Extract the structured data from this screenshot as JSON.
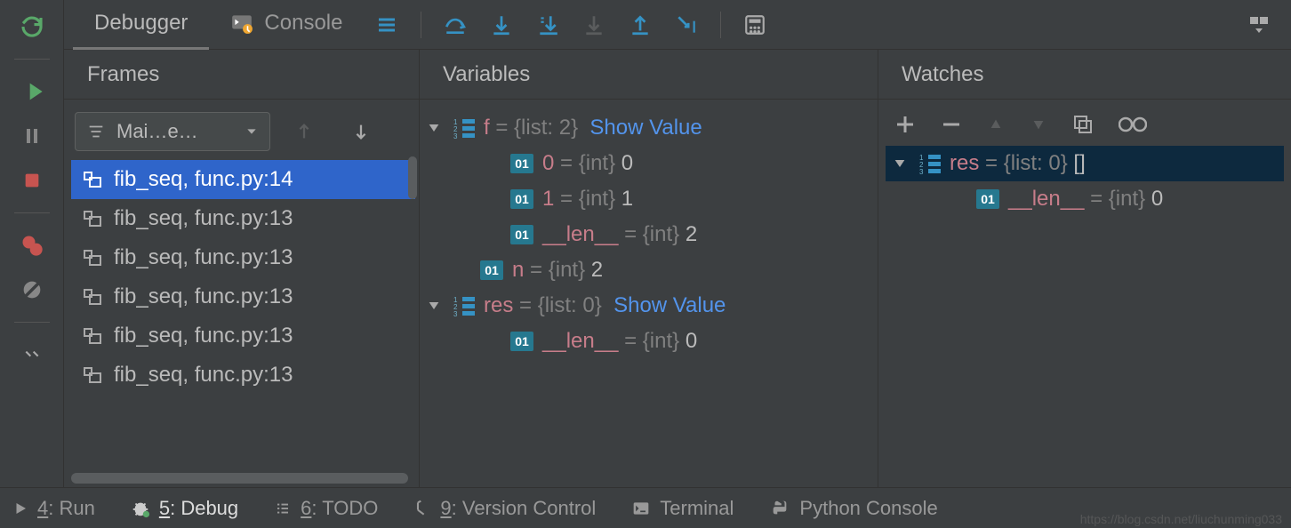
{
  "tabs": {
    "debugger": "Debugger",
    "console": "Console"
  },
  "panels": {
    "frames": "Frames",
    "variables": "Variables",
    "watches": "Watches"
  },
  "frames": {
    "thread_select": "Mai…e…",
    "items": [
      {
        "label": "fib_seq, func.py:14",
        "selected": true
      },
      {
        "label": "fib_seq, func.py:13",
        "selected": false
      },
      {
        "label": "fib_seq, func.py:13",
        "selected": false
      },
      {
        "label": "fib_seq, func.py:13",
        "selected": false
      },
      {
        "label": "fib_seq, func.py:13",
        "selected": false
      },
      {
        "label": "fib_seq, func.py:13",
        "selected": false
      }
    ]
  },
  "variables": {
    "f": {
      "name": "f",
      "type": "{list: 2}",
      "link": "Show Value",
      "children": [
        {
          "key": "0",
          "k_dunder": false,
          "type": "{int}",
          "value": "0"
        },
        {
          "key": "1",
          "k_dunder": false,
          "type": "{int}",
          "value": "1"
        },
        {
          "key": "__len__",
          "k_dunder": true,
          "type": "{int}",
          "value": "2"
        }
      ]
    },
    "n": {
      "name": "n",
      "type": "{int}",
      "value": "2"
    },
    "res": {
      "name": "res",
      "type": "{list: 0}",
      "link": "Show Value",
      "children": [
        {
          "key": "__len__",
          "k_dunder": true,
          "type": "{int}",
          "value": "0"
        }
      ]
    }
  },
  "watches": {
    "res": {
      "name": "res",
      "type": "{list: 0}",
      "repr": "[]",
      "children": [
        {
          "key": "__len__",
          "k_dunder": true,
          "type": "{int}",
          "value": "0"
        }
      ]
    }
  },
  "bottom": {
    "run": {
      "key": "4",
      "label": ": Run"
    },
    "debug": {
      "key": "5",
      "label": ": Debug"
    },
    "todo": {
      "key": "6",
      "label": ": TODO"
    },
    "vcs": {
      "key": "9",
      "label": ": Version Control"
    },
    "terminal": "Terminal",
    "pyconsole": "Python Console"
  },
  "watermark": "https://blog.csdn.net/liuchunming033"
}
